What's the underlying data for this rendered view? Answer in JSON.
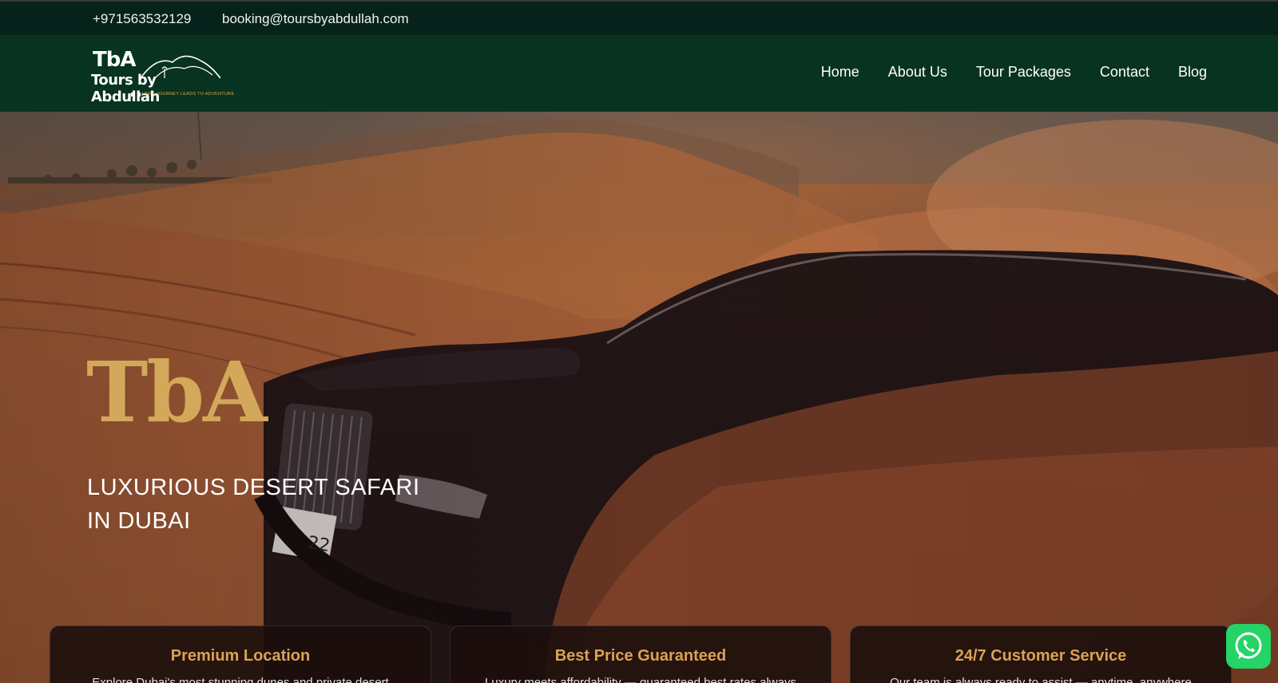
{
  "topbar": {
    "phone": "+971563532129",
    "email": "booking@toursbyabdullah.com"
  },
  "logo": {
    "line1": "TbA",
    "line2": "Tours by Abdullah",
    "tagline": "VERY JOURNEY LEADS TO ADVENTURE"
  },
  "nav": {
    "items": [
      {
        "label": "Home"
      },
      {
        "label": "About Us"
      },
      {
        "label": "Tour Packages"
      },
      {
        "label": "Contact"
      },
      {
        "label": "Blog"
      }
    ]
  },
  "hero": {
    "brand": "TbA",
    "title": "LUXURIOUS DESERT SAFARI IN DUBAI",
    "plate_number": "22"
  },
  "cards": [
    {
      "title": "Premium Location",
      "text": "Explore Dubai's most stunning dunes and private desert"
    },
    {
      "title": "Best Price Guaranteed",
      "text": "Luxury meets affordability — guaranteed best rates always"
    },
    {
      "title": "24/7 Customer Service",
      "text": "Our team is always ready to assist — anytime, anywhere"
    }
  ],
  "colors": {
    "topbar_bg": "#05231a",
    "header_bg": "#083321",
    "accent_gold": "#d4a85a",
    "whatsapp_green": "#25d366"
  },
  "icons": {
    "whatsapp": "whatsapp-icon"
  }
}
